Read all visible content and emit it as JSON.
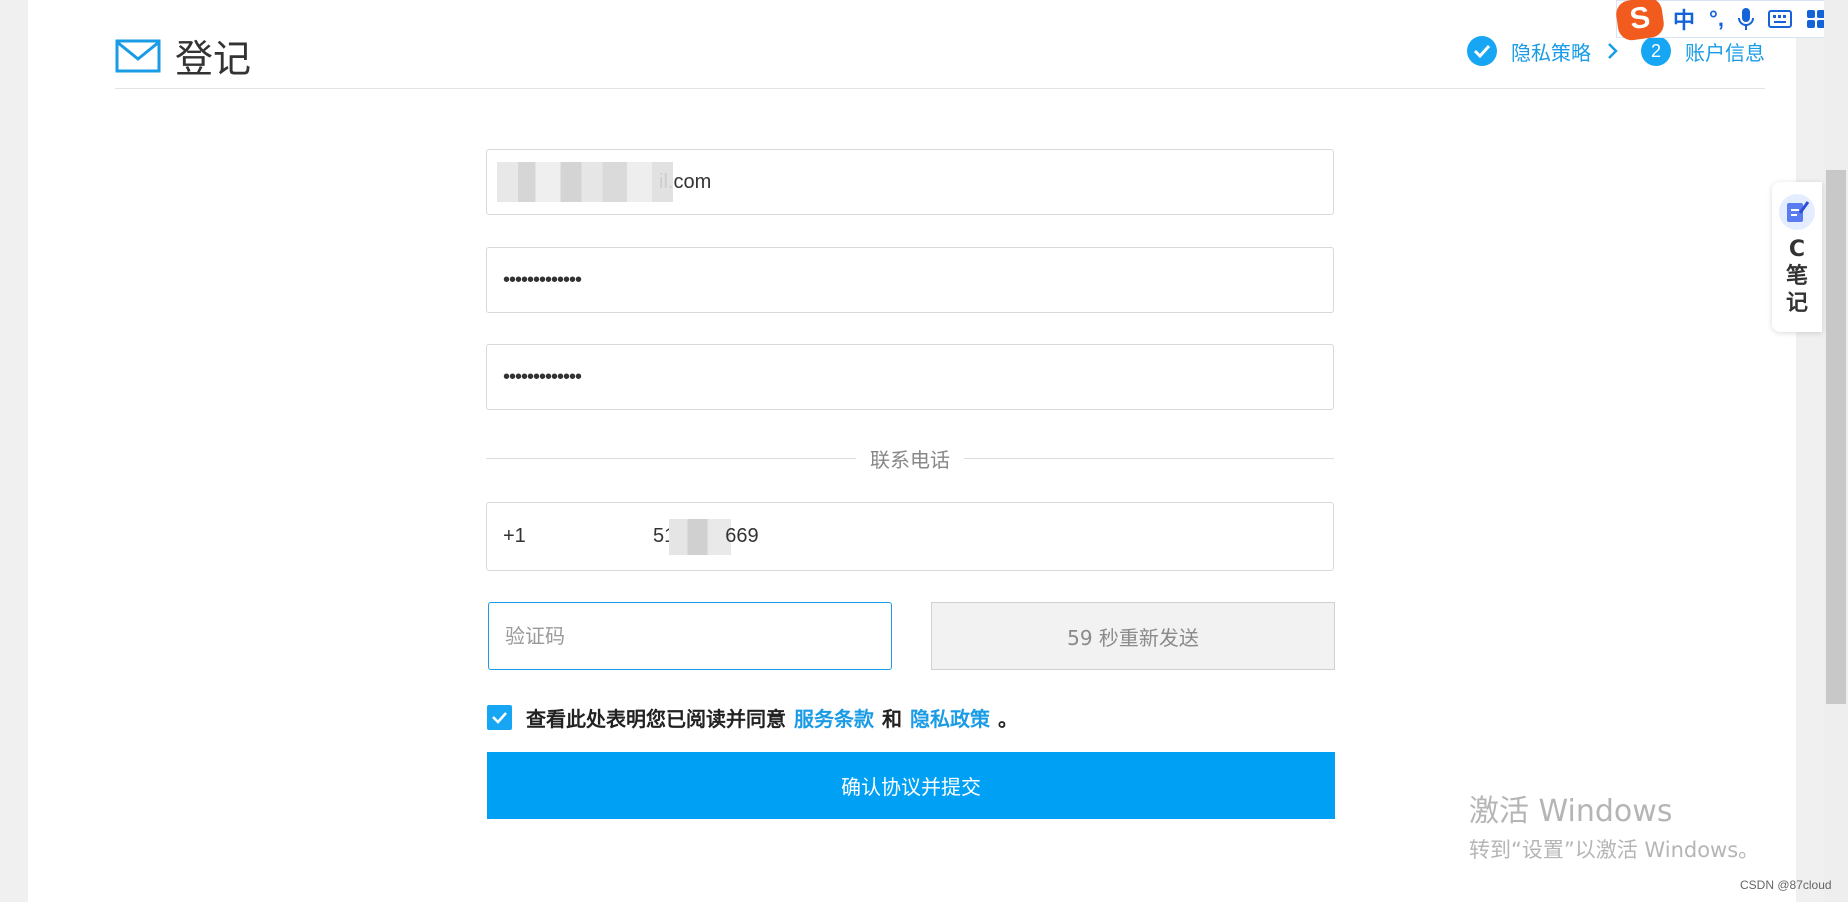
{
  "header": {
    "title": "登记",
    "steps": [
      {
        "label": "隐私策略",
        "status": "done"
      },
      {
        "number": "2",
        "label": "账户信息",
        "status": "current"
      }
    ]
  },
  "form": {
    "email_value_suffix": "il.com",
    "password_value": "•••••••••••••",
    "confirm_password_value": "•••••••••••••",
    "phone_section_label": "联系电话",
    "phone_country_code": "+1",
    "phone_prefix": "51",
    "phone_suffix": "669",
    "code_placeholder": "验证码",
    "resend_label": "59 秒重新发送",
    "agree_text": "查看此处表明您已阅读并同意",
    "terms_link": "服务条款",
    "and_text": "和",
    "privacy_link": "隐私政策",
    "period": "。",
    "submit_label": "确认协议并提交"
  },
  "ime": {
    "logo": "S",
    "mode": "中",
    "punct": "°,"
  },
  "side_tool": {
    "label": "C笔记"
  },
  "watermark": {
    "title": "激活 Windows",
    "subtitle": "转到“设置”以激活 Windows。"
  },
  "footer": {
    "credit": "CSDN @87cloud"
  },
  "colors": {
    "accent": "#16a6f3",
    "submit": "#00a1f4",
    "ime": "#1463d8"
  }
}
